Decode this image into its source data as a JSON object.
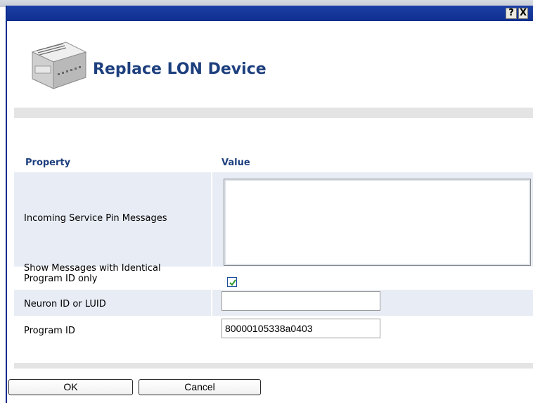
{
  "titlebar": {
    "help_glyph": "?",
    "close_glyph": "X"
  },
  "dialog": {
    "title": "Replace LON Device",
    "icon": "lon-device-icon"
  },
  "table": {
    "headers": {
      "property": "Property",
      "value": "Value"
    },
    "rows": {
      "incoming": {
        "label": "Incoming Service Pin Messages",
        "value": ""
      },
      "identical": {
        "label_line1": "Show Messages with Identical",
        "label_line2": "Program ID only",
        "checked": true
      },
      "neuron": {
        "label": "Neuron ID or LUID",
        "value": ""
      },
      "program": {
        "label": "Program ID",
        "value": "80000105338a0403"
      }
    }
  },
  "buttons": {
    "ok": "OK",
    "cancel": "Cancel"
  },
  "colors": {
    "titlebar": "#102f8f",
    "heading": "#1d3f7e",
    "row_background": "#e8ecf4",
    "checkbox_check": "#2e9a2e"
  }
}
